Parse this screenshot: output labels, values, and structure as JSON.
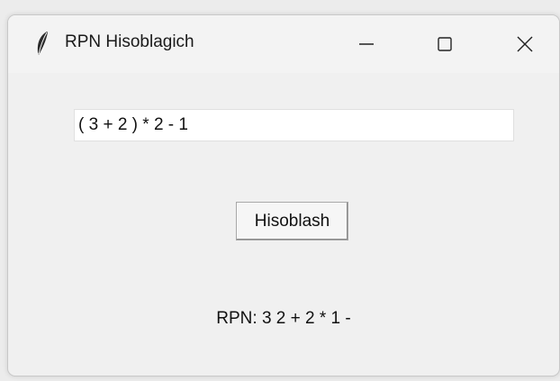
{
  "window": {
    "title": "RPN Hisoblagich",
    "icon": "feather-icon",
    "controls": {
      "minimize": "minimize-icon",
      "maximize": "maximize-icon",
      "close": "close-icon"
    }
  },
  "form": {
    "expression_value": "( 3 + 2 ) * 2 - 1",
    "button_label": "Hisoblash",
    "result_text": "RPN: 3 2 + 2 * 1 -"
  },
  "colors": {
    "background": "#f0f0f0",
    "input_background": "#ffffff",
    "text": "#111111"
  }
}
